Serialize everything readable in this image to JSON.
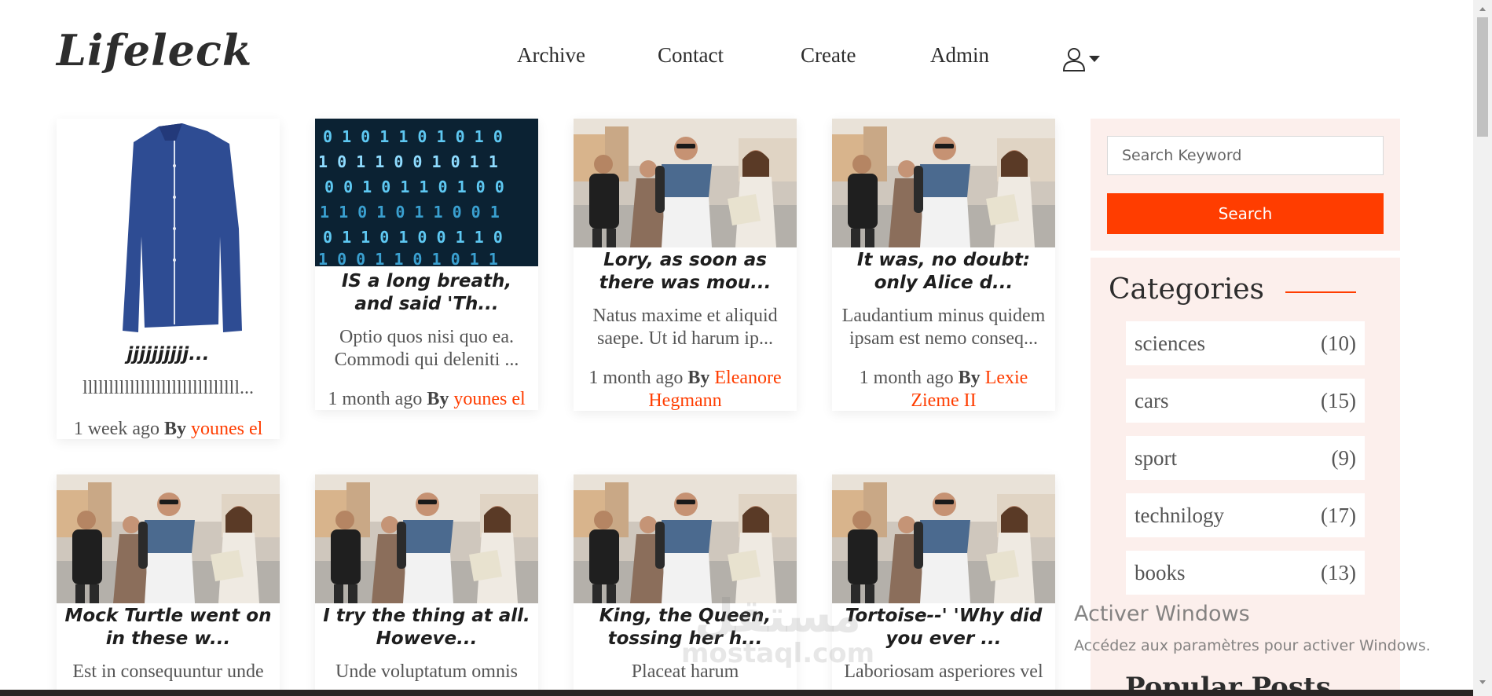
{
  "header": {
    "logo": "Lifeleck",
    "nav": [
      {
        "label": "Archive"
      },
      {
        "label": "Contact"
      },
      {
        "label": "Create"
      },
      {
        "label": "Admin"
      }
    ]
  },
  "posts": [
    {
      "title": "jjjjjjjjjj...",
      "excerpt": "llllllllllllllllllllllllllllll...",
      "time": "1 week ago",
      "by": "By",
      "author": "younes el"
    },
    {
      "title": "IS a long breath, and said 'Th...",
      "excerpt": "Optio quos nisi quo ea. Commodi qui deleniti ...",
      "time": "1 month ago",
      "by": "By",
      "author": "younes el"
    },
    {
      "title": "Lory, as soon as there was mou...",
      "excerpt": "Natus maxime et aliquid saepe. Ut id harum ip...",
      "time": "1 month ago",
      "by": "By",
      "author": "Eleanore Hegmann"
    },
    {
      "title": "It was, no doubt: only Alice d...",
      "excerpt": "Laudantium minus quidem ipsam est nemo conseq...",
      "time": "1 month ago",
      "by": "By",
      "author": "Lexie Zieme II"
    },
    {
      "title": "Mock Turtle went on in these w...",
      "excerpt": "Est in consequuntur unde"
    },
    {
      "title": "I try the thing at all. Howeve...",
      "excerpt": "Unde voluptatum omnis"
    },
    {
      "title": "King, the Queen, tossing her h...",
      "excerpt": "Placeat harum"
    },
    {
      "title": "Tortoise--' 'Why did you ever ...",
      "excerpt": "Laboriosam asperiores vel"
    }
  ],
  "sidebar": {
    "search": {
      "placeholder": "Search Keyword",
      "button": "Search"
    },
    "categories_title": "Categories",
    "categories": [
      {
        "name": "sciences",
        "count": "(10)"
      },
      {
        "name": "cars",
        "count": "(15)"
      },
      {
        "name": "sport",
        "count": "(9)"
      },
      {
        "name": "technilogy",
        "count": "(17)"
      },
      {
        "name": "books",
        "count": "(13)"
      }
    ],
    "popular_title": "Popular Posts"
  },
  "overlay": {
    "watermark_arabic": "مستقل",
    "watermark_url": "mostaql.com",
    "activate_title": "Activer Windows",
    "activate_sub": "Accédez aux paramètres pour activer Windows."
  },
  "colors": {
    "accent": "#ff3d00",
    "sidebar_bg": "#fcefec"
  },
  "icons": [
    "user-icon",
    "caret-down-icon"
  ]
}
